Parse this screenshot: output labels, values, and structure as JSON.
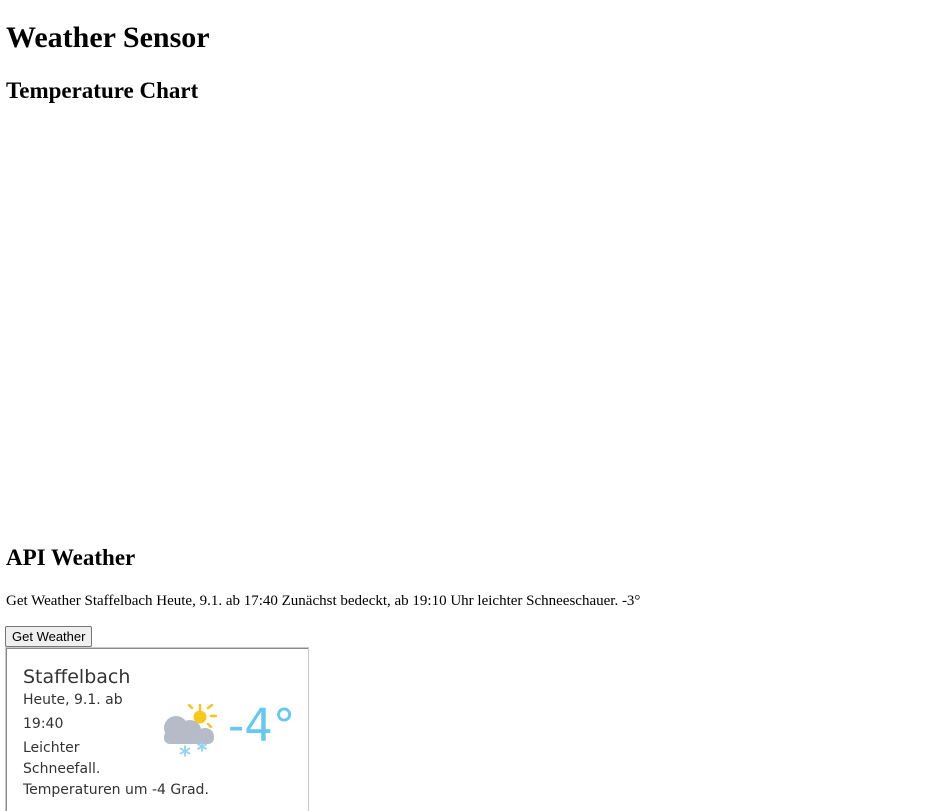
{
  "page": {
    "title": "Weather Sensor",
    "chart_heading": "Temperature Chart",
    "api_heading": "API Weather",
    "api_text": "Get Weather Staffelbach Heute, 9.1. ab 17:40 Zunächst bedeckt, ab 19:10 Uhr leichter Schneeschauer. -3°",
    "get_weather_button": "Get Weather"
  },
  "widget": {
    "city": "Staffelbach",
    "date_line": "Heute, 9.1. ab",
    "time_line": "19:40",
    "desc_line1": "Leichter",
    "desc_line2": "Schneefall.",
    "desc_line3": "Temperaturen um -4 Grad.",
    "temperature": "-4°",
    "icon": "cloud-snow-sun-icon",
    "temp_color": "#66c8f0"
  }
}
